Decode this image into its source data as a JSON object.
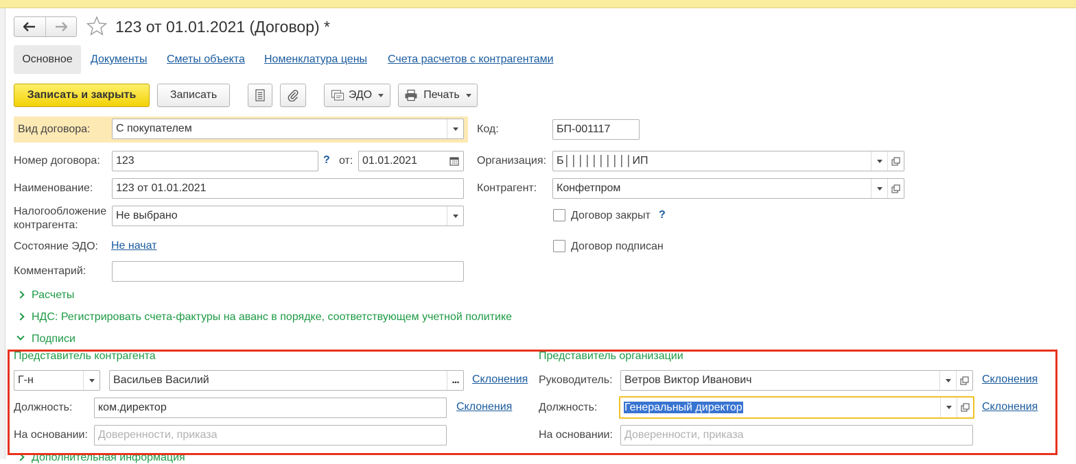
{
  "window": {
    "title": "123 от 01.01.2021 (Договор) *"
  },
  "tabs": [
    {
      "label": "Основное",
      "active": true
    },
    {
      "label": "Документы"
    },
    {
      "label": "Сметы объекта"
    },
    {
      "label": "Номенклатура цены"
    },
    {
      "label": "Счета расчетов с контрагентами"
    }
  ],
  "toolbar": {
    "save_close": "Записать и закрыть",
    "save": "Записать",
    "edo": "ЭДО",
    "print": "Печать"
  },
  "form": {
    "contract_type": {
      "label": "Вид договора:",
      "value": "С покупателем"
    },
    "contract_number": {
      "label": "Номер договора:",
      "value": "123",
      "help": "?"
    },
    "date": {
      "label": "от:",
      "value": "01.01.2021"
    },
    "name": {
      "label": "Наименование:",
      "value": "123 от 01.01.2021"
    },
    "taxation": {
      "label": "Налогообложение контрагента:",
      "label_line1": "Налогообложение",
      "label_line2": "контрагента:",
      "value": "Не выбрано"
    },
    "edo_state": {
      "label": "Состояние ЭДО:",
      "value": "Не начат"
    },
    "comment": {
      "label": "Комментарий:",
      "value": ""
    },
    "code": {
      "label": "Код:",
      "value": "БП-001117"
    },
    "organization": {
      "label": "Организация:",
      "value": "Б││││││││││ИП"
    },
    "counterparty": {
      "label": "Контрагент:",
      "value": "Конфетпром"
    },
    "contract_closed": {
      "label": "Договор закрыт",
      "checked": false,
      "help": "?"
    },
    "contract_signed": {
      "label": "Договор подписан",
      "checked": false
    }
  },
  "sections": {
    "payments": "Расчеты",
    "vat": "НДС: Регистрировать счета-фактуры на аванс в порядке, соответствующем учетной политике",
    "signatures": "Подписи",
    "additional": "Дополнительная информация"
  },
  "signatures": {
    "counterparty_rep": {
      "title": "Представитель контрагента",
      "salutation": "Г-н",
      "person": "Васильев Василий",
      "declension_link": "Склонения",
      "position_label": "Должность:",
      "position": "ком.директор",
      "position_declension": "Склонения",
      "basis_label": "На основании:",
      "basis_placeholder": "Доверенности, приказа"
    },
    "organization_rep": {
      "title": "Представитель организации",
      "head_label": "Руководитель:",
      "head": "Ветров Виктор Иванович",
      "declension_link": "Склонения",
      "position_label": "Должность:",
      "position": "Генеральный директор",
      "position_declension": "Склонения",
      "basis_label": "На основании:",
      "basis_placeholder": "Доверенности, приказа"
    }
  },
  "colors": {
    "highlight_row": "#fde9b4",
    "primary_button": "#f3d208",
    "link": "#1a5b9e",
    "section_green": "#1d9a45",
    "annotation_box": "#e8321d",
    "selection": "#3874d1"
  },
  "icons": [
    "back-arrow-icon",
    "forward-arrow-icon",
    "star-icon",
    "list-icon",
    "paperclip-icon",
    "edo-icon",
    "printer-icon",
    "calendar-icon",
    "open-form-icon",
    "dropdown-icon",
    "chevron-right-icon",
    "chevron-down-icon"
  ]
}
